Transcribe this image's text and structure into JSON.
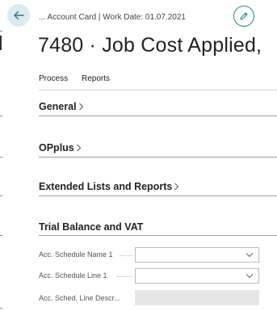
{
  "header": {
    "breadcrumb": "... Account Card | Work Date: 01.07.2021",
    "title": "7480 · Job Cost Applied,"
  },
  "icons": {
    "back": "arrow-left-icon",
    "edit": "pencil-icon",
    "chevron_right": "chevron-right-icon",
    "chevron_down": "chevron-down-icon"
  },
  "actions": {
    "process": "Process",
    "reports": "Reports"
  },
  "sections": {
    "general": "General",
    "opplus": "OPplus",
    "extended": "Extended Lists and Reports",
    "trial": "Trial Balance and VAT"
  },
  "fields": {
    "acc_schedule_name_1": {
      "label": "Acc. Schedule Name 1",
      "value": ""
    },
    "acc_schedule_line_1": {
      "label": "Acc. Schedule Line 1",
      "value": ""
    },
    "acc_sched_line_descr": {
      "label": "Acc. Sched. Line Descr...",
      "value": ""
    }
  },
  "colors": {
    "accent": "#1f8a8a",
    "back_button_bg": "#d9ecef"
  }
}
